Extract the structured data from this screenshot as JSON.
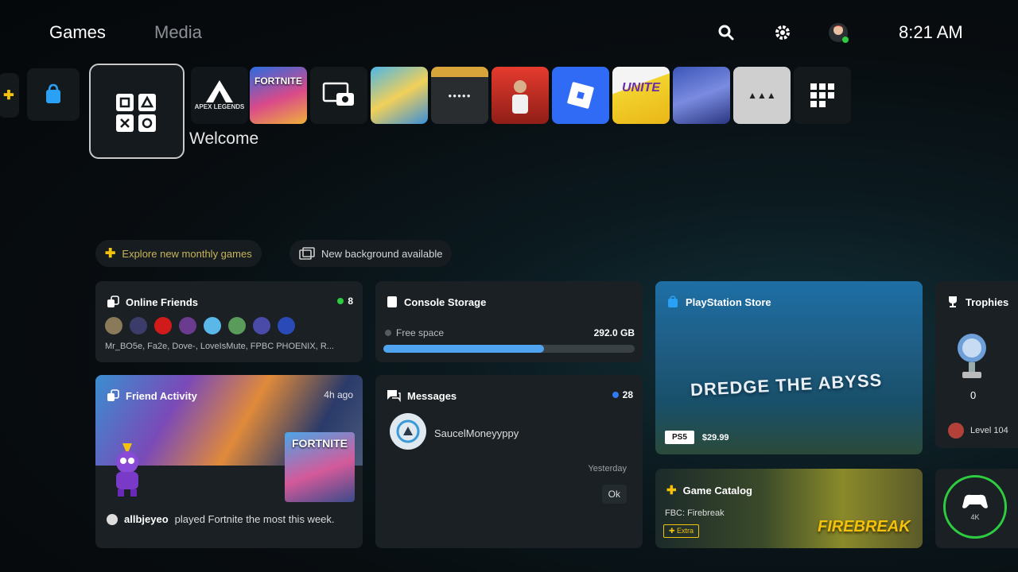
{
  "header": {
    "tabs": [
      "Games",
      "Media"
    ],
    "clock": "8:21 AM"
  },
  "launcher": {
    "tiles": [
      {
        "name": "ps-store",
        "label": ""
      },
      {
        "name": "apex-legends",
        "label": "APEX LEGENDS"
      },
      {
        "name": "fortnite",
        "label": "FORTNITE"
      },
      {
        "name": "media-gallery",
        "label": ""
      },
      {
        "name": "game-1",
        "label": ""
      },
      {
        "name": "game-2",
        "label": ""
      },
      {
        "name": "game-3",
        "label": ""
      },
      {
        "name": "roblox",
        "label": ""
      },
      {
        "name": "pokemon-unite",
        "label": "UNITE"
      },
      {
        "name": "game-4",
        "label": ""
      },
      {
        "name": "game-5",
        "label": ""
      },
      {
        "name": "game-library",
        "label": ""
      }
    ],
    "welcome_label": "Welcome"
  },
  "chips": {
    "explore": "Explore new monthly games",
    "background": "New background available"
  },
  "online_friends": {
    "title": "Online Friends",
    "count": "8",
    "names": "Mr_BO5e, Fa2e, Dove-, LoveIsMute, FPBC PHOENIX, R..."
  },
  "console_storage": {
    "title": "Console Storage",
    "label": "Free space",
    "value": "292.0 GB",
    "fill_fraction": 0.64
  },
  "ps_store": {
    "title": "PlayStation Store",
    "badge": "PS5",
    "price": "$29.99",
    "banner_text": "DREDGE THE ABYSS"
  },
  "trophies": {
    "title": "Trophies",
    "count": "0",
    "level": "Level 104"
  },
  "friend_activity": {
    "title": "Friend Activity",
    "time": "4h ago",
    "user": "allbjeyeo",
    "text": "played Fortnite the most this week."
  },
  "messages": {
    "title": "Messages",
    "count": "28",
    "sender": "SaucelMoneyyppy",
    "time": "Yesterday",
    "preview": "Ok"
  },
  "game_catalog": {
    "title": "Game Catalog",
    "subtitle": "FBC: Firebreak",
    "badge": "Extra",
    "art_text": "FIREBREAK"
  },
  "controller": {
    "label": "4K"
  }
}
